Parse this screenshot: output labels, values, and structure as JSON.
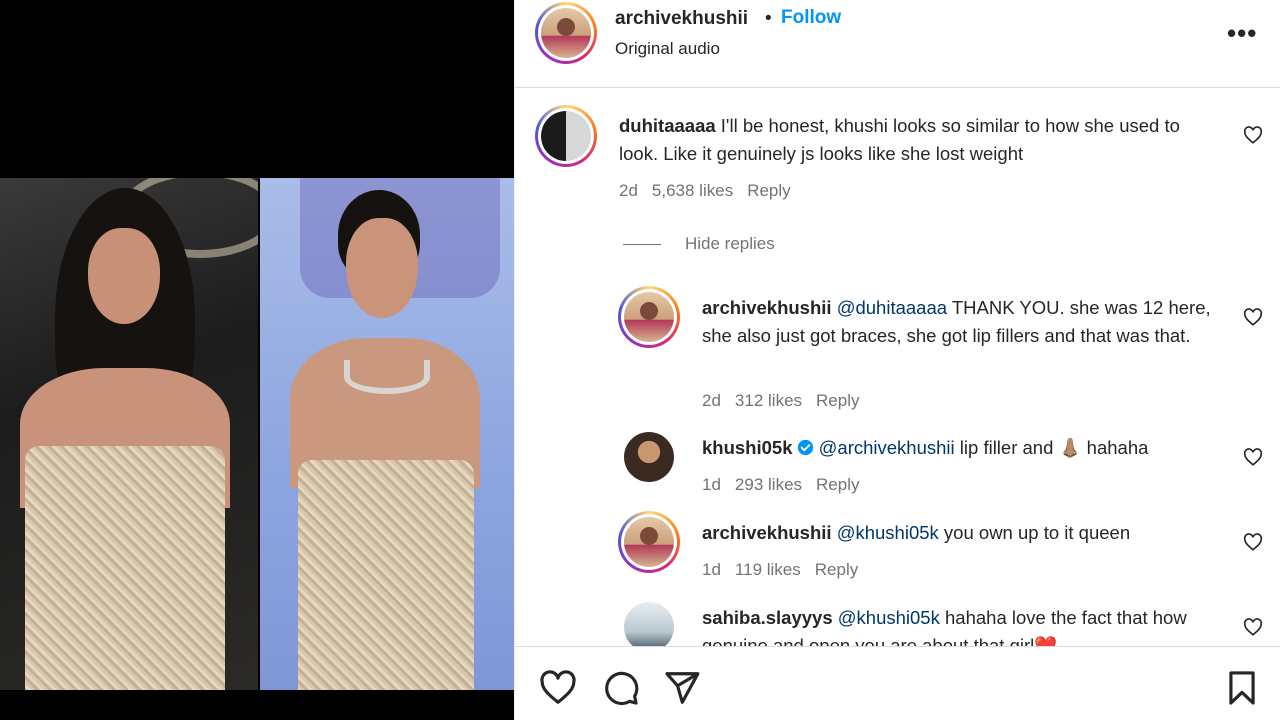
{
  "header": {
    "username": "archivekhushii",
    "dot": "•",
    "follow_label": "Follow",
    "audio": "Original audio",
    "more_label": "•••"
  },
  "hide_replies_label": "Hide replies",
  "comments": [
    {
      "username": "duhitaaaaa",
      "text": " I'll be honest, khushi looks so similar to how she used to look. Like it genuinely js looks like she lost weight",
      "time": "2d",
      "likes": "5,638 likes",
      "reply": "Reply"
    },
    {
      "username": "archivekhushii",
      "mention": "@duhitaaaaa",
      "text": " THANK YOU. she was 12 here, she also just got braces, she got lip fillers and that was that.",
      "time": "2d",
      "likes": "312 likes",
      "reply": "Reply"
    },
    {
      "username": "khushi05k",
      "mention": "@archivekhushii",
      "text": " lip filler and 👃🏽 hahaha",
      "time": "1d",
      "likes": "293 likes",
      "reply": "Reply"
    },
    {
      "username": "archivekhushii",
      "mention": "@khushi05k",
      "text": " you own up to it queen",
      "time": "1d",
      "likes": "119 likes",
      "reply": "Reply"
    },
    {
      "username": "sahiba.slayyys",
      "mention": "@khushi05k",
      "text": " hahaha love the fact that how genuine and open you are about that girl❤️"
    }
  ],
  "colors": {
    "accent": "#0095f6",
    "mention": "#00376b",
    "muted": "#737373",
    "text": "#262626"
  }
}
